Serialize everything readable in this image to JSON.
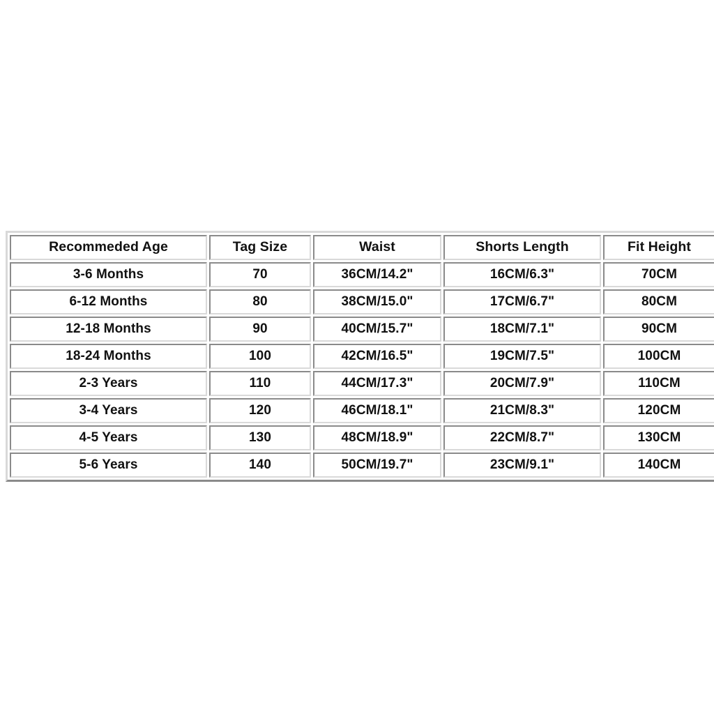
{
  "page": {
    "background_color": "#ffffff",
    "text_color": "#111111",
    "border_dark": "#8a8a8a",
    "border_light": "#d9d9d9"
  },
  "table": {
    "name": "kids-shorts-size-chart",
    "columns": [
      "Recommeded Age",
      "Tag Size",
      "Waist",
      "Shorts Length",
      "Fit Height"
    ],
    "rows": [
      {
        "age": "3-6 Months",
        "tag_size": "70",
        "waist": "36CM/14.2\"",
        "shorts_length": "16CM/6.3\"",
        "fit_height": "70CM"
      },
      {
        "age": "6-12 Months",
        "tag_size": "80",
        "waist": "38CM/15.0\"",
        "shorts_length": "17CM/6.7\"",
        "fit_height": "80CM"
      },
      {
        "age": "12-18 Months",
        "tag_size": "90",
        "waist": "40CM/15.7\"",
        "shorts_length": "18CM/7.1\"",
        "fit_height": "90CM"
      },
      {
        "age": "18-24 Months",
        "tag_size": "100",
        "waist": "42CM/16.5\"",
        "shorts_length": "19CM/7.5\"",
        "fit_height": "100CM"
      },
      {
        "age": "2-3 Years",
        "tag_size": "110",
        "waist": "44CM/17.3\"",
        "shorts_length": "20CM/7.9\"",
        "fit_height": "110CM"
      },
      {
        "age": "3-4 Years",
        "tag_size": "120",
        "waist": "46CM/18.1\"",
        "shorts_length": "21CM/8.3\"",
        "fit_height": "120CM"
      },
      {
        "age": "4-5 Years",
        "tag_size": "130",
        "waist": "48CM/18.9\"",
        "shorts_length": "22CM/8.7\"",
        "fit_height": "130CM"
      },
      {
        "age": "5-6 Years",
        "tag_size": "140",
        "waist": "50CM/19.7\"",
        "shorts_length": "23CM/9.1\"",
        "fit_height": "140CM"
      }
    ]
  }
}
